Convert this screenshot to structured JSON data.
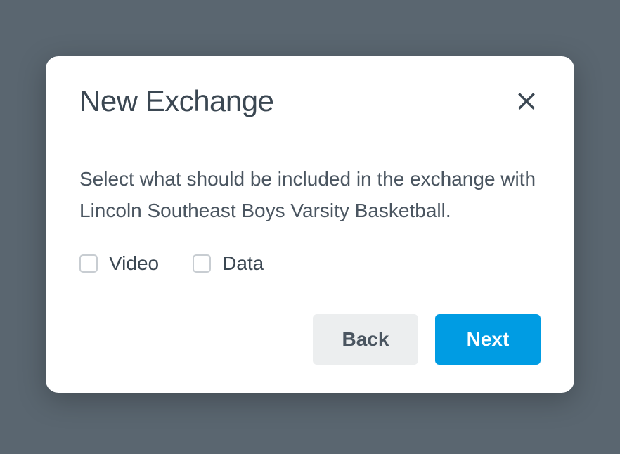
{
  "modal": {
    "title": "New Exchange",
    "description": "Select what should be included in the exchange with Lincoln Southeast Boys Varsity Basketball.",
    "checkboxes": [
      {
        "label": "Video"
      },
      {
        "label": "Data"
      }
    ],
    "buttons": {
      "back": "Back",
      "next": "Next"
    }
  }
}
